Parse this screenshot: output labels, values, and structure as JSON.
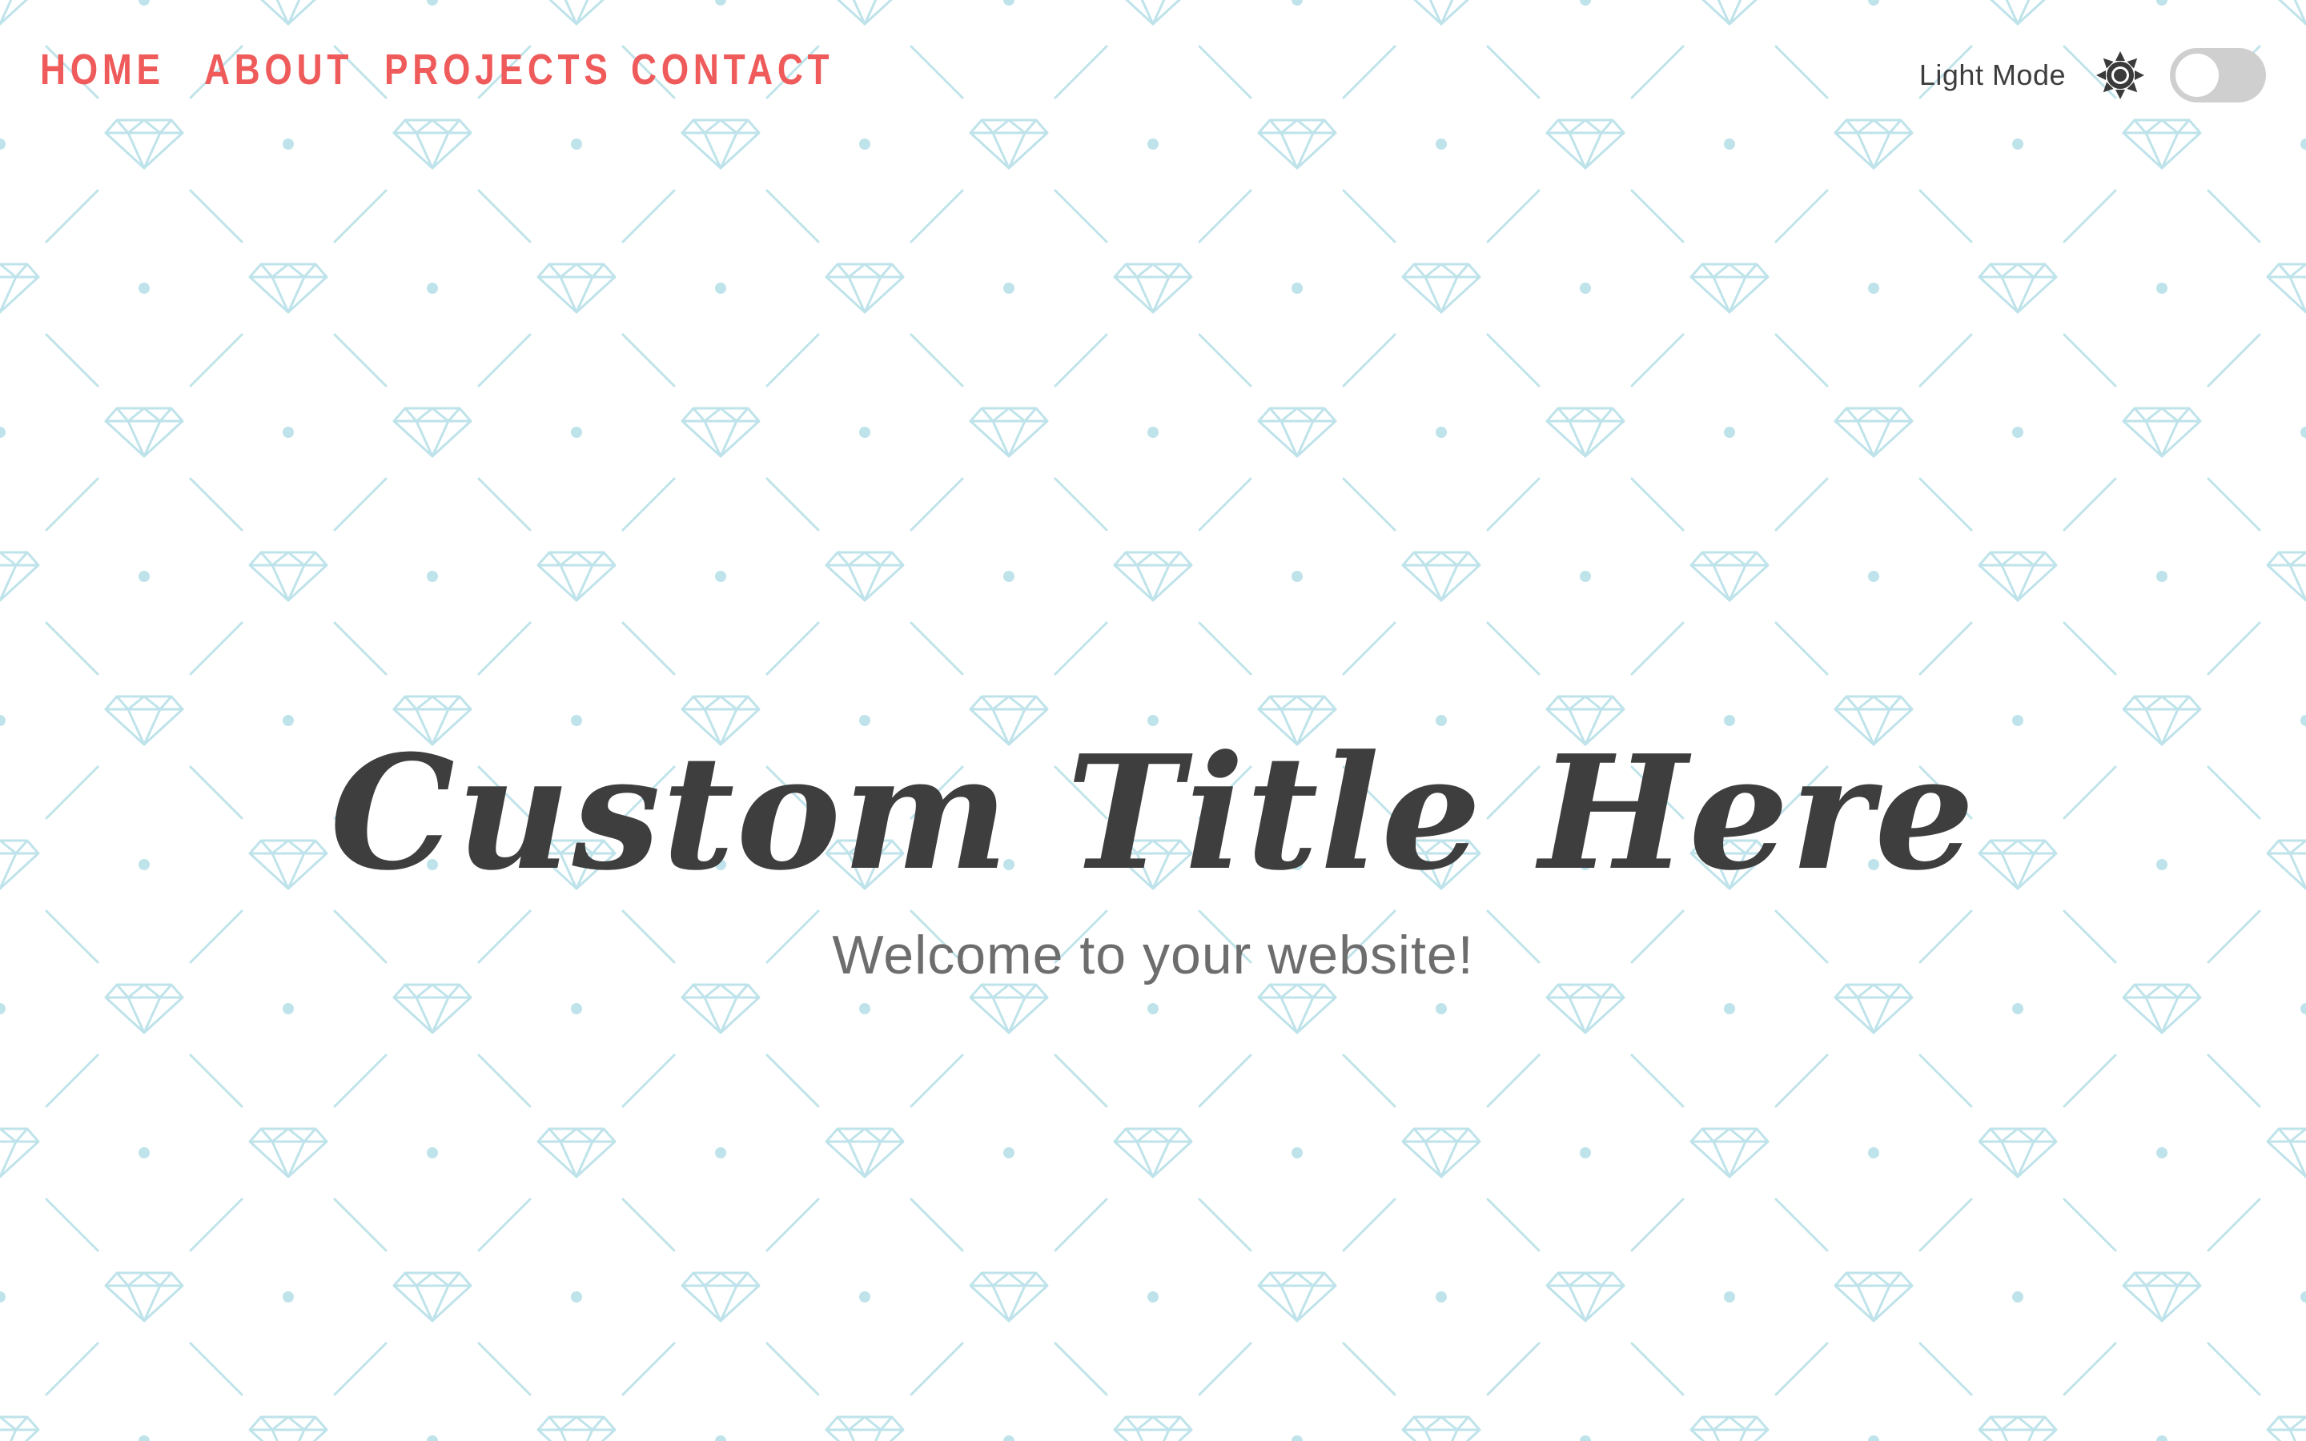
{
  "nav": {
    "items": [
      {
        "label": "HOME"
      },
      {
        "label": "ABOUT"
      },
      {
        "label": "PROJECTS"
      },
      {
        "label": "CONTACT"
      }
    ]
  },
  "theme": {
    "label": "Light Mode",
    "icon": "sun-icon",
    "toggle_on": false
  },
  "hero": {
    "title": "Custom Title Here",
    "subtitle": "Welcome to your website!"
  },
  "colors": {
    "nav_accent": "#ef5a5a",
    "title": "#3e3e3e",
    "subtitle": "#6d6d6d",
    "pattern": "#bfe3ea",
    "toggle_track": "#cfcfcf"
  }
}
